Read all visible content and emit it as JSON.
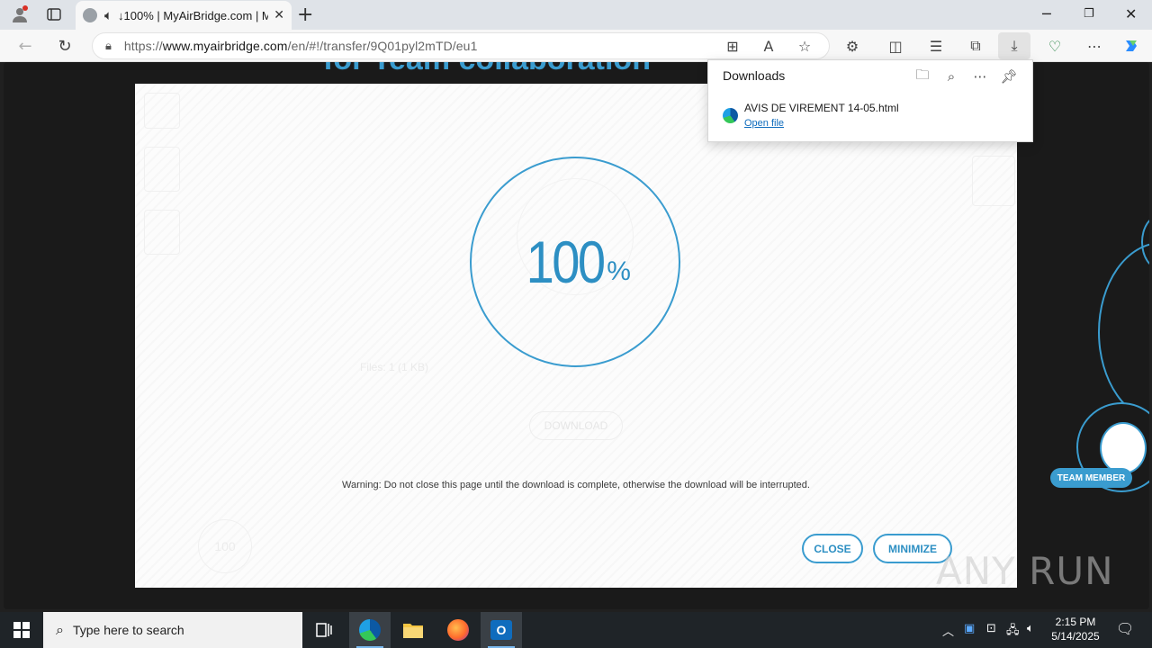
{
  "browser": {
    "tab_title": "100% | MyAirBridge.com | M",
    "tab_progress": "↓",
    "url_prefix": "https://",
    "url_domain": "www.myairbridge.com",
    "url_path": "/en/#!/transfer/9Q01pyl2mTD/eu1",
    "icons": [
      "profile-icon",
      "tab-actions-icon",
      "cloud-favicon",
      "speaker-icon",
      "close-tab-icon",
      "new-tab-icon",
      "minimize-icon",
      "restore-icon",
      "close-window-icon",
      "back-icon",
      "refresh-icon",
      "lock-icon",
      "apps-icon",
      "read-aloud-icon",
      "favorite-star-icon",
      "extensions-icon",
      "split-screen-icon",
      "favorites-icon",
      "collections-icon",
      "downloads-icon",
      "browser-essentials-icon",
      "more-icon",
      "copilot-icon"
    ]
  },
  "downloads": {
    "title": "Downloads",
    "items": [
      {
        "name": "AVIS DE VIREMENT 14-05.html",
        "action": "Open file"
      }
    ]
  },
  "page": {
    "heading": "for Team collaboration",
    "progress": {
      "value": "100",
      "unit": "%"
    },
    "files_label": "Files: 1",
    "files_size": "(1 KB)",
    "download_label": "DOWNLOAD",
    "warning": "Warning: Do not close this page until the download is complete, otherwise the download will be interrupted.",
    "close_label": "CLOSE",
    "minimize_label": "MINIMIZE",
    "mini_progress": "100",
    "team_badge": "TEAM MEMBER",
    "accent_color": "#3a9ccf"
  },
  "watermark": "ANY RUN",
  "taskbar": {
    "search_placeholder": "Type here to search",
    "time": "2:15 PM",
    "date": "5/14/2025",
    "apps": [
      "task-view-icon",
      "edge-icon",
      "file-explorer-icon",
      "firefox-icon",
      "outlook-icon"
    ]
  }
}
